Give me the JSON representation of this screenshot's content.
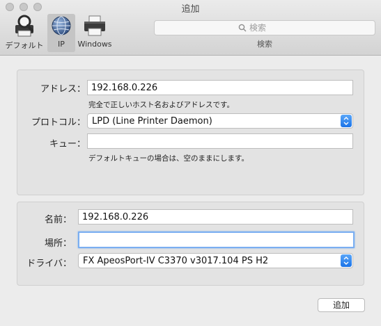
{
  "window": {
    "title": "追加"
  },
  "toolbar": {
    "items": [
      {
        "label": "デフォルト",
        "icon": "magnifier-printer-icon"
      },
      {
        "label": "IP",
        "icon": "globe-icon",
        "selected": true
      },
      {
        "label": "Windows",
        "icon": "printer-icon"
      }
    ],
    "search": {
      "placeholder": "検索",
      "caption": "検索"
    }
  },
  "ip_panel": {
    "address": {
      "label": "アドレス：",
      "value": "192.168.0.226",
      "hint": "完全で正しいホスト名およびアドレスです。"
    },
    "protocol": {
      "label": "プロトコル：",
      "value": "LPD (Line Printer Daemon)"
    },
    "queue": {
      "label": "キュー：",
      "value": "",
      "hint": "デフォルトキューの場合は、空のままにします。"
    }
  },
  "printer_panel": {
    "name": {
      "label": "名前：",
      "value": "192.168.0.226"
    },
    "location": {
      "label": "場所：",
      "value": ""
    },
    "driver": {
      "label": "ドライバ：",
      "value": "FX ApeosPort-IV C3370 v3017.104 PS H2"
    }
  },
  "footer": {
    "add_label": "追加"
  },
  "colors": {
    "accent": "#1a73e8",
    "focus_ring": "#7aaef1",
    "panel_bg": "#e3e3e3",
    "window_bg": "#ececec"
  }
}
